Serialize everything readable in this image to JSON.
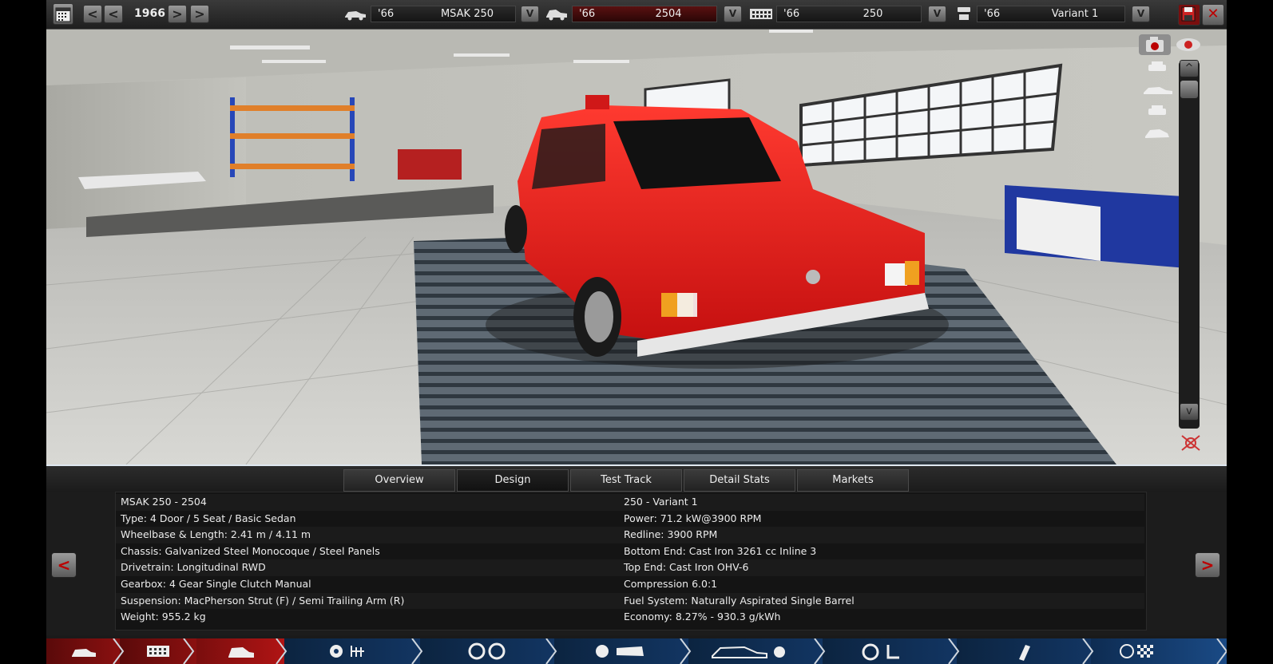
{
  "topbar": {
    "year": "1966",
    "prev_fast": "<",
    "prev": "<",
    "next": ">",
    "next_fast": ">",
    "model": {
      "year": "'66",
      "name": "MSAK 250"
    },
    "trim": {
      "year": "'66",
      "name": "2504"
    },
    "engine": {
      "year": "'66",
      "name": "250"
    },
    "variant": {
      "year": "'66",
      "name": "Variant 1"
    },
    "dropdown_label": "V"
  },
  "viewport": {
    "scroll_up": "^",
    "scroll_down": "v"
  },
  "tabs": [
    {
      "label": "Overview"
    },
    {
      "label": "Design"
    },
    {
      "label": "Test Track"
    },
    {
      "label": "Detail Stats"
    },
    {
      "label": "Markets"
    }
  ],
  "info": {
    "left": [
      "MSAK 250 - 2504",
      "Type: 4 Door / 5 Seat / Basic Sedan",
      "Wheelbase & Length: 2.41 m / 4.11 m",
      "Chassis: Galvanized Steel Monocoque / Steel Panels",
      "Drivetrain: Longitudinal RWD",
      "Gearbox: 4 Gear Single Clutch Manual",
      "Suspension: MacPherson Strut (F) / Semi Trailing Arm (R)",
      "Weight: 955.2 kg"
    ],
    "right": [
      "250 - Variant 1",
      "Power: 71.2 kW@3900 RPM",
      "Redline: 3900 RPM",
      "Bottom End: Cast Iron 3261 cc Inline 3",
      "Top End: Cast Iron OHV-6",
      "Compression 6.0:1",
      "Fuel System: Naturally Aspirated Single Barrel",
      "Economy: 8.27% - 930.3 g/kWh"
    ],
    "prev_arrow": "<",
    "next_arrow": ">"
  },
  "colors": {
    "car": "#e01818",
    "accent_red": "#b31212",
    "bottom_active": "#7a0e0e",
    "bottom_nav": "#0e2a4a"
  },
  "icons": {
    "calendar": "calendar-icon",
    "save": "save-icon",
    "close": "close-icon",
    "camera": "camera-icon",
    "eye": "eye-icon"
  }
}
